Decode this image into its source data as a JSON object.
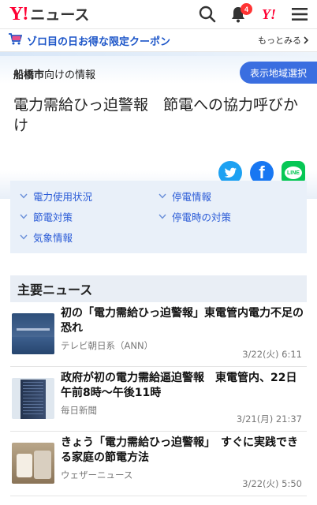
{
  "header": {
    "logo_y": "Y!",
    "logo_text": "ニュース",
    "notification_count": "4",
    "yahoo_icon": "Y!",
    "icons": [
      "search-icon",
      "bell-icon",
      "yahoo-icon",
      "menu-icon"
    ]
  },
  "coupon": {
    "text": "ゾロ目の日お得な限定クーポン",
    "more_label": "もっとみる",
    "icon": "cart-icon"
  },
  "hero": {
    "region_name": "船橋市",
    "region_suffix": "向けの情報",
    "region_button": "表示地域選択",
    "title": "電力需給ひっ迫警報　節電への協力呼びかけ",
    "share": [
      "twitter-icon",
      "facebook-icon",
      "line-icon"
    ],
    "line_label": "LINE",
    "facebook_label": "f"
  },
  "links": [
    {
      "label": "電力使用状況"
    },
    {
      "label": "停電情報"
    },
    {
      "label": "節電対策"
    },
    {
      "label": "停電時の対策"
    },
    {
      "label": "気象情報"
    }
  ],
  "news": {
    "heading": "主要ニュース",
    "items": [
      {
        "title": "初の「電力需給ひっ迫警報」東電管内電力不足の恐れ",
        "source": "テレビ朝日系（ANN）",
        "date": "3/22(火) 6:11"
      },
      {
        "title": "政府が初の電力需給逼迫警報　東電管内、22日午前8時～午後11時",
        "source": "毎日新聞",
        "date": "3/21(月) 21:37"
      },
      {
        "title": "きょう「電力需給ひっ迫警報」　すぐに実践できる家庭の節電方法",
        "source": "ウェザーニュース",
        "date": "3/22(火) 5:50"
      }
    ]
  },
  "colors": {
    "brand_red": "#ff0033",
    "link_blue": "#2a5bd7",
    "button_blue": "#3a6ee0"
  }
}
